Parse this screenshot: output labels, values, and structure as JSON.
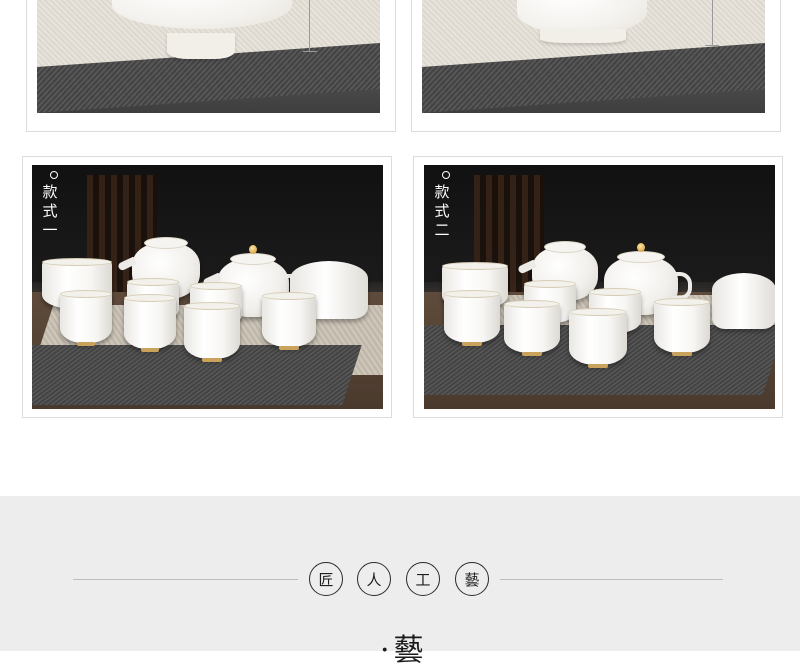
{
  "product_cards": [
    {
      "label_chars": [
        "款",
        "式",
        "一"
      ]
    },
    {
      "label_chars": [
        "款",
        "式",
        "二"
      ]
    }
  ],
  "craft_banner": {
    "characters": [
      "匠",
      "人",
      "工",
      "藝"
    ],
    "title_partial": "·藝"
  }
}
